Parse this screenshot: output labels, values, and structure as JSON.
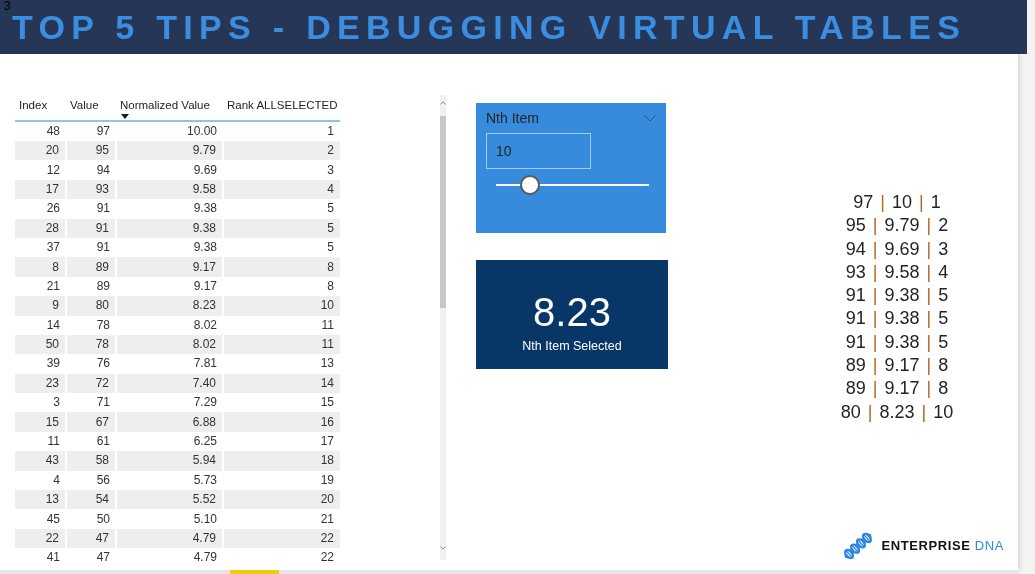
{
  "corner_label": "3",
  "title": "TOP 5 TIPS - DEBUGGING VIRTUAL TABLES",
  "table": {
    "columns": [
      {
        "label": "Index",
        "sorted": false
      },
      {
        "label": "Value",
        "sorted": false
      },
      {
        "label": "Normalized Value",
        "sorted": true
      },
      {
        "label": "Rank ALLSELECTED",
        "sorted": false
      }
    ],
    "rows": [
      [
        "48",
        "97",
        "10.00",
        "1"
      ],
      [
        "20",
        "95",
        "9.79",
        "2"
      ],
      [
        "12",
        "94",
        "9.69",
        "3"
      ],
      [
        "17",
        "93",
        "9.58",
        "4"
      ],
      [
        "26",
        "91",
        "9.38",
        "5"
      ],
      [
        "28",
        "91",
        "9.38",
        "5"
      ],
      [
        "37",
        "91",
        "9.38",
        "5"
      ],
      [
        "8",
        "89",
        "9.17",
        "8"
      ],
      [
        "21",
        "89",
        "9.17",
        "8"
      ],
      [
        "9",
        "80",
        "8.23",
        "10"
      ],
      [
        "14",
        "78",
        "8.02",
        "11"
      ],
      [
        "50",
        "78",
        "8.02",
        "11"
      ],
      [
        "39",
        "76",
        "7.81",
        "13"
      ],
      [
        "23",
        "72",
        "7.40",
        "14"
      ],
      [
        "3",
        "71",
        "7.29",
        "15"
      ],
      [
        "15",
        "67",
        "6.88",
        "16"
      ],
      [
        "11",
        "61",
        "6.25",
        "17"
      ],
      [
        "43",
        "58",
        "5.94",
        "18"
      ],
      [
        "4",
        "56",
        "5.73",
        "19"
      ],
      [
        "13",
        "54",
        "5.52",
        "20"
      ],
      [
        "45",
        "50",
        "5.10",
        "21"
      ],
      [
        "22",
        "47",
        "4.79",
        "22"
      ],
      [
        "41",
        "47",
        "4.79",
        "22"
      ]
    ]
  },
  "slicer": {
    "title": "Nth Item",
    "value": "10",
    "level": 0.22
  },
  "card": {
    "value": "8.23",
    "label": "Nth Item Selected"
  },
  "concat_list": {
    "separator": "|",
    "lines": [
      [
        "97",
        "10",
        "1"
      ],
      [
        "95",
        "9.79",
        "2"
      ],
      [
        "94",
        "9.69",
        "3"
      ],
      [
        "93",
        "9.58",
        "4"
      ],
      [
        "91",
        "9.38",
        "5"
      ],
      [
        "91",
        "9.38",
        "5"
      ],
      [
        "91",
        "9.38",
        "5"
      ],
      [
        "89",
        "9.17",
        "8"
      ],
      [
        "89",
        "9.17",
        "8"
      ],
      [
        "80",
        "8.23",
        "10"
      ]
    ]
  },
  "logo": {
    "words": [
      "ENTERPRISE",
      "DNA"
    ]
  }
}
